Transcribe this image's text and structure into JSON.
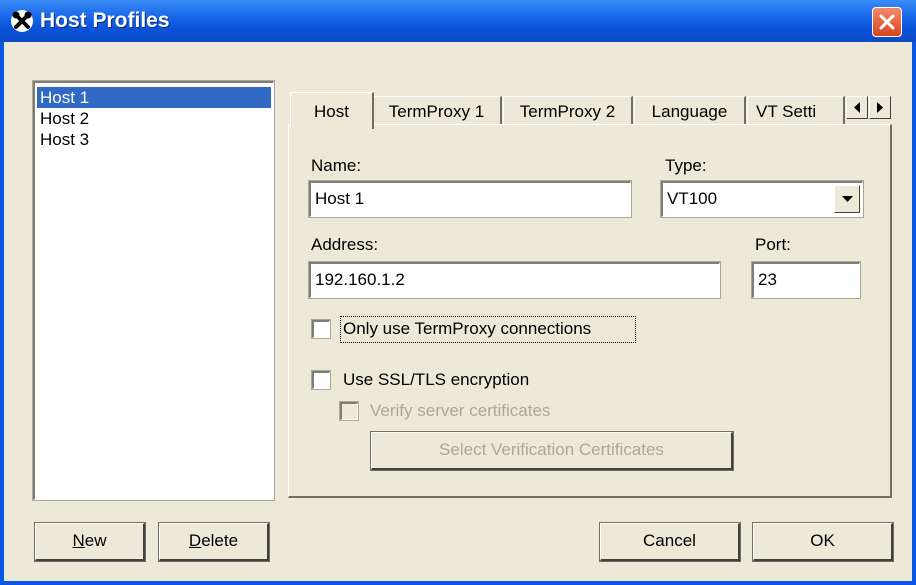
{
  "window": {
    "title": "Host Profiles",
    "icon": "tools-icon",
    "close_icon": "close-icon",
    "title_color": "#0a57e6",
    "close_color": "#d8451f"
  },
  "hosts": {
    "items": [
      "Host 1",
      "Host 2",
      "Host 3"
    ],
    "selected": "Host 1",
    "selection_color": "#316ac5"
  },
  "tabs": {
    "items": [
      "Host",
      "TermProxy 1",
      "TermProxy 2",
      "Language",
      "VT Setti"
    ],
    "active": "Host",
    "scroll_left_icon": "arrow-left-icon",
    "scroll_right_icon": "arrow-right-icon"
  },
  "form": {
    "name_label": "Name:",
    "name_value": "Host 1",
    "type_label": "Type:",
    "type_value": "VT100",
    "address_label": "Address:",
    "address_value": "192.160.1.2",
    "port_label": "Port:",
    "port_value": "23",
    "termproxy_only_label": "Only use TermProxy connections",
    "termproxy_only_checked": false,
    "ssl_label": "Use SSL/TLS encryption",
    "ssl_checked": false,
    "verify_label": "Verify server certificates",
    "verify_checked": false,
    "select_certs_label": "Select Verification Certificates"
  },
  "buttons": {
    "new_label_underlined": "N",
    "new_label_rest": "ew",
    "delete_label_underlined": "D",
    "delete_label_rest": "elete",
    "cancel_label": "Cancel",
    "ok_label": "OK"
  }
}
